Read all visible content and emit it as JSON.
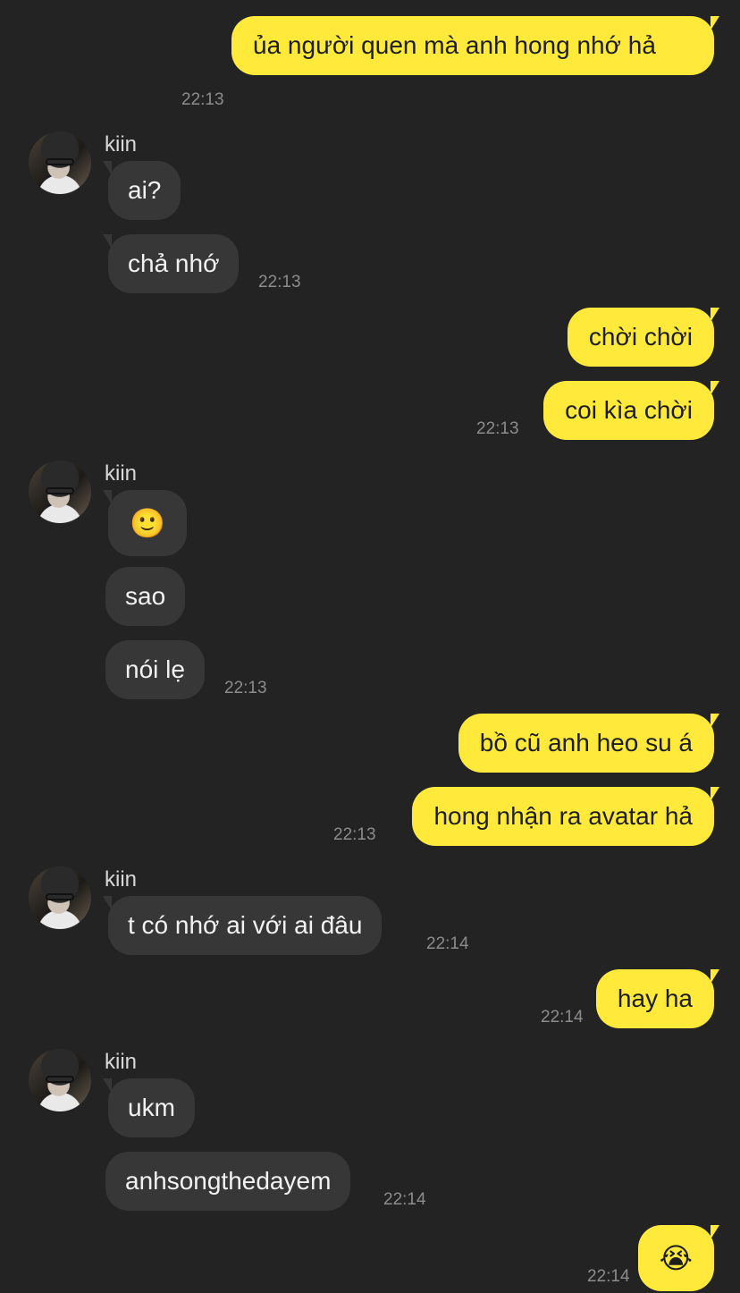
{
  "contact": {
    "name": "kiin"
  },
  "colors": {
    "background": "#232323",
    "outgoing": "#ffea3b",
    "incoming": "#373737"
  },
  "messages": [
    {
      "from": "me",
      "text": "ủa người quen mà anh hong nhớ hả",
      "time": "22:13"
    },
    {
      "from": "kiin",
      "text": "ai?"
    },
    {
      "from": "kiin",
      "text": "chả nhớ",
      "time": "22:13"
    },
    {
      "from": "me",
      "text": "chời chời"
    },
    {
      "from": "me",
      "text": "coi kìa chời",
      "time": "22:13"
    },
    {
      "from": "kiin",
      "text": "🙂"
    },
    {
      "from": "kiin",
      "text": "sao"
    },
    {
      "from": "kiin",
      "text": "nói lẹ",
      "time": "22:13"
    },
    {
      "from": "me",
      "text": "bồ cũ anh heo su á"
    },
    {
      "from": "me",
      "text": "hong nhận ra avatar hả",
      "time": "22:13"
    },
    {
      "from": "kiin",
      "text": "t có nhớ ai với ai đâu",
      "time": "22:14"
    },
    {
      "from": "me",
      "text": "hay ha",
      "time": "22:14"
    },
    {
      "from": "kiin",
      "text": "ukm"
    },
    {
      "from": "kiin",
      "text": "anhsongthedayem",
      "time": "22:14"
    },
    {
      "from": "me",
      "text": "😭",
      "time": "22:14"
    }
  ]
}
